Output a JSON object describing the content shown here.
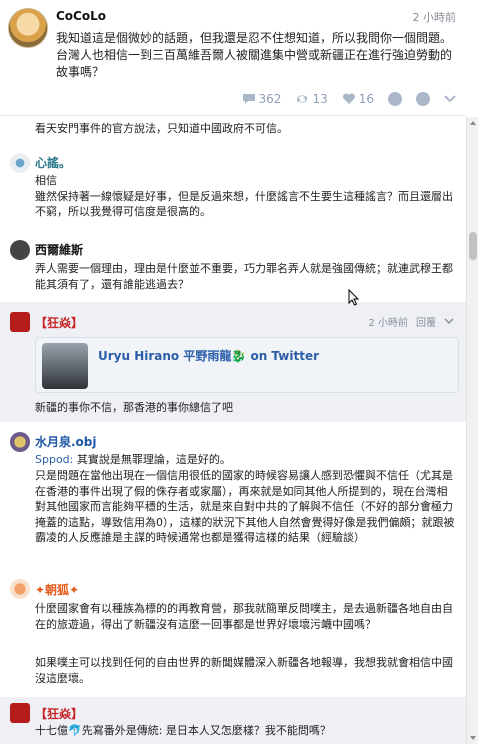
{
  "post": {
    "author": "CoCoLo",
    "time": "2 小時前",
    "body": "我知道這是個微妙的話題，但我還是忍不住想知道，所以我問你一個問題。台灣人也相信一到三百萬維吾爾人被關進集中營或新疆正在進行強迫勞動的故事嗎？",
    "stats": {
      "comments": "362",
      "reposts": "13",
      "likes": "16"
    }
  },
  "comments": [
    {
      "name": "",
      "text": "看天安門事件的官方說法，只知道中國政府不可信。"
    },
    {
      "name": "心謠。",
      "text": "相信\n雖然保持著一線懷疑是好事，但是反過來想，什麼謠言不生要生這種謠言？而且還層出不窮，所以我覺得可信度是很高的。"
    },
    {
      "name": "西爾維斯",
      "text": "弄人需要一個理由，理由是什麼並不重要，巧力罪名弄人就是強國傳統；就連武穆王都能其須有了，還有誰能逃過去？"
    },
    {
      "name": "【狂焱】",
      "time": "2 小時前",
      "reply": "回覆",
      "embed_title": "Uryu Hirano 平野雨龍🐉 on Twitter",
      "text": "新疆的事你不信，那香港的事你總信了吧"
    },
    {
      "name": "水月泉.obj",
      "mention": "Sppod:",
      "text_first": " 其實說是無罪理論，這是好的。",
      "text": "只是問題在當他出現在一個信用很低的國家的時候容易讓人感到恐懼與不信任（尤其是在香港的事件出現了假的侏存者或家屬），再來就是如同其他人所提到的，現在台灣相對其他國家而言能夠平穩的生活，就是來自對中共的了解與不信任（不好的部分會極力掩蓋的這點，導致信用為0），這樣的狀況下其他人自然會覺得好像是我們偏頗；就跟被霸凌的人反應誰是主謀的時候通常也都是獲得這樣的結果（經驗談）"
    },
    {
      "name": "✦朝狐✦",
      "text": "什麼國家會有以種族為標的的再教育營，那我就簡單反問噗主，是去過新疆各地自由自在的旅遊過，得出了新疆沒有這麼一回事都是世界好壞壞污衊中國嗎？",
      "text2": "如果噗主可以找到任何的自由世界的新聞媒體深入新疆各地報導，我想我就會相信中國沒這麼壞。"
    },
    {
      "name": "【狂焱】",
      "text": "十七億🐬先寫番外是傳統: 是日本人又怎麼樣？我不能問嗎？"
    }
  ]
}
